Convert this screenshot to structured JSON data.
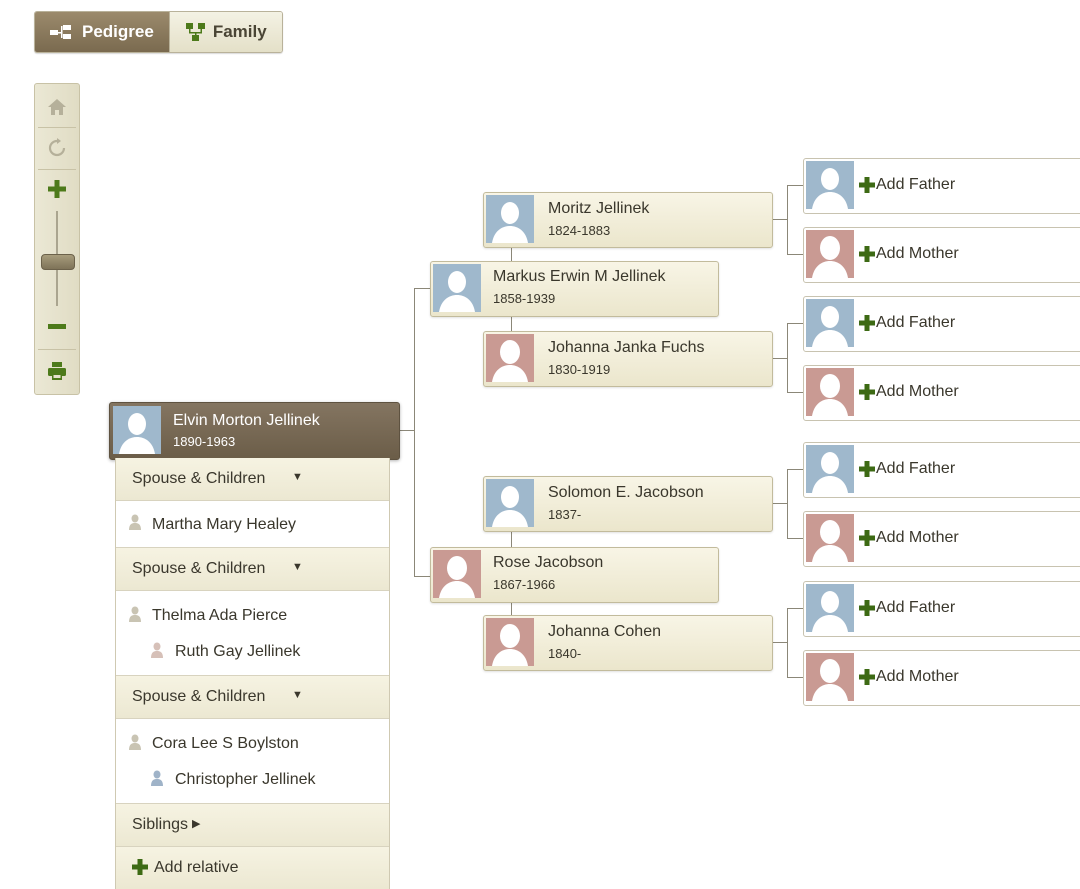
{
  "view_toggle": {
    "pedigree_label": "Pedigree",
    "family_label": "Family",
    "active": "Pedigree"
  },
  "toolbar": {
    "icons": [
      "home-icon",
      "refresh-icon",
      "zoom-in-icon",
      "zoom-slider",
      "zoom-out-icon",
      "print-icon"
    ]
  },
  "root_person": {
    "name": "Elvin Morton Jellinek",
    "dates": "1890-1963",
    "gender": "male"
  },
  "family_panel": {
    "spouse_groups": [
      {
        "header": "Spouse & Children",
        "spouse": "Martha Mary Healey",
        "children": []
      },
      {
        "header": "Spouse & Children",
        "spouse": "Thelma Ada Pierce",
        "children": [
          "Ruth Gay Jellinek"
        ]
      },
      {
        "header": "Spouse & Children",
        "spouse": "Cora Lee S Boylston",
        "children": [
          "Christopher Jellinek"
        ]
      }
    ],
    "siblings_label": "Siblings",
    "add_relative_label": "Add relative"
  },
  "parents": [
    {
      "name": "Markus Erwin M Jellinek",
      "dates": "1858-1939",
      "gender": "male"
    },
    {
      "name": "Rose Jacobson",
      "dates": "1867-1966",
      "gender": "female"
    }
  ],
  "grandparents": [
    {
      "name": "Moritz Jellinek",
      "dates": "1824-1883",
      "gender": "male"
    },
    {
      "name": "Johanna Janka Fuchs",
      "dates": "1830-1919",
      "gender": "female"
    },
    {
      "name": "Solomon E. Jacobson",
      "dates": "1837-",
      "gender": "male"
    },
    {
      "name": "Johanna Cohen",
      "dates": "1840-",
      "gender": "female"
    }
  ],
  "great_grandparent_placeholders": [
    {
      "label": "Add Father",
      "gender": "male"
    },
    {
      "label": "Add Mother",
      "gender": "female"
    },
    {
      "label": "Add Father",
      "gender": "male"
    },
    {
      "label": "Add Mother",
      "gender": "female"
    },
    {
      "label": "Add Father",
      "gender": "male"
    },
    {
      "label": "Add Mother",
      "gender": "female"
    },
    {
      "label": "Add Father",
      "gender": "male"
    },
    {
      "label": "Add Mother",
      "gender": "female"
    }
  ],
  "colors": {
    "male_avatar": "#9fb8cc",
    "female_avatar": "#c99a93",
    "active_toggle": "#8a7a5e",
    "root_card": "#77684f",
    "add_plus": "#3d6a14"
  }
}
